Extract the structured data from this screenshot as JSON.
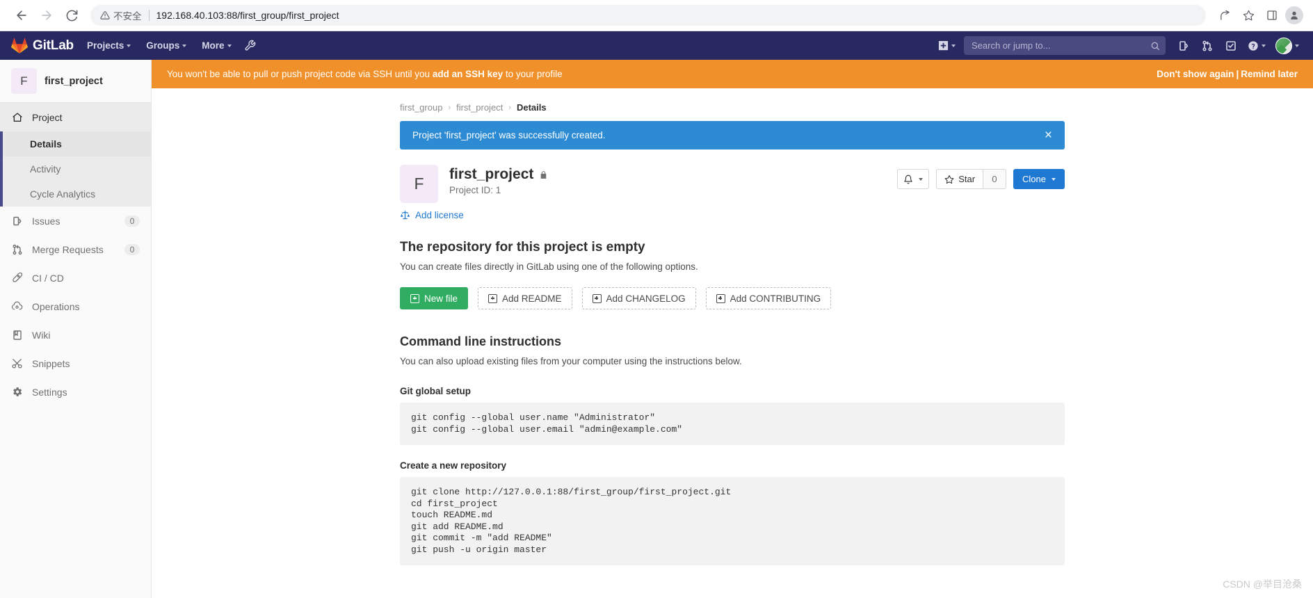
{
  "browser": {
    "back_icon": "back-arrow-icon",
    "forward_icon": "forward-arrow-icon",
    "reload_icon": "reload-icon",
    "security_label": "不安全",
    "url": "192.168.40.103:88/first_group/first_project",
    "share_icon": "share-icon",
    "bookmark_icon": "star-outline-icon",
    "sidepanel_icon": "side-panel-icon",
    "profile_icon": "profile-avatar-icon"
  },
  "navbar": {
    "logo_text": "GitLab",
    "items": [
      {
        "label": "Projects",
        "has_caret": true
      },
      {
        "label": "Groups",
        "has_caret": true
      },
      {
        "label": "More",
        "has_caret": true
      }
    ],
    "admin_icon": "wrench-icon",
    "plus_icon": "plus-square-icon",
    "search_placeholder": "Search or jump to...",
    "search_value": "",
    "search_icon": "search-icon",
    "issues_icon": "issues-icon",
    "merge_requests_icon": "merge-request-icon",
    "todos_icon": "todo-checkmark-icon",
    "help_icon": "question-circle-icon",
    "avatar_icon": "user-avatar-icon"
  },
  "sidebar": {
    "project_initial": "F",
    "project_name": "first_project",
    "project_group": {
      "label": "Project",
      "icon": "home-icon",
      "subitems": [
        {
          "label": "Details",
          "active": true
        },
        {
          "label": "Activity",
          "active": false
        },
        {
          "label": "Cycle Analytics",
          "active": false
        }
      ]
    },
    "items": [
      {
        "label": "Issues",
        "icon": "issues-icon",
        "badge": "0"
      },
      {
        "label": "Merge Requests",
        "icon": "merge-request-icon",
        "badge": "0"
      },
      {
        "label": "CI / CD",
        "icon": "rocket-icon",
        "badge": ""
      },
      {
        "label": "Operations",
        "icon": "cloud-gear-icon",
        "badge": ""
      },
      {
        "label": "Wiki",
        "icon": "book-icon",
        "badge": ""
      },
      {
        "label": "Snippets",
        "icon": "scissors-icon",
        "badge": ""
      },
      {
        "label": "Settings",
        "icon": "gear-icon",
        "badge": ""
      }
    ]
  },
  "ssh_banner": {
    "text_before": "You won't be able to pull or push project code via SSH until you ",
    "link_text": "add an SSH key",
    "text_after": " to your profile",
    "dont_show_again": "Don't show again",
    "separator": "|",
    "remind_later": "Remind later"
  },
  "breadcrumb": {
    "group": "first_group",
    "project": "first_project",
    "current": "Details",
    "separator": "›"
  },
  "alert": {
    "message": "Project 'first_project' was successfully created.",
    "close_label": "×",
    "color": "#2d8bd4"
  },
  "project": {
    "initial": "F",
    "name": "first_project",
    "visibility_icon": "lock-icon",
    "id_label": "Project ID: 1",
    "notify_icon": "bell-icon",
    "star_icon": "star-icon",
    "star_label": "Star",
    "star_count": "0",
    "clone_label": "Clone",
    "add_license_label": "Add license",
    "add_license_icon": "scale-balance-icon"
  },
  "empty_repo": {
    "title": "The repository for this project is empty",
    "subtitle": "You can create files directly in GitLab using one of the following options.",
    "buttons": [
      {
        "label": "New file",
        "style": "primary"
      },
      {
        "label": "Add README",
        "style": "dashed"
      },
      {
        "label": "Add CHANGELOG",
        "style": "dashed"
      },
      {
        "label": "Add CONTRIBUTING",
        "style": "dashed"
      }
    ]
  },
  "cli": {
    "title": "Command line instructions",
    "subtitle": "You can also upload existing files from your computer using the instructions below.",
    "sections": [
      {
        "title": "Git global setup",
        "code": "git config --global user.name \"Administrator\"\ngit config --global user.email \"admin@example.com\""
      },
      {
        "title": "Create a new repository",
        "code": "git clone http://127.0.0.1:88/first_group/first_project.git\ncd first_project\ntouch README.md\ngit add README.md\ngit commit -m \"add README\"\ngit push -u origin master"
      }
    ]
  },
  "watermark": "CSDN @举目沧桑"
}
